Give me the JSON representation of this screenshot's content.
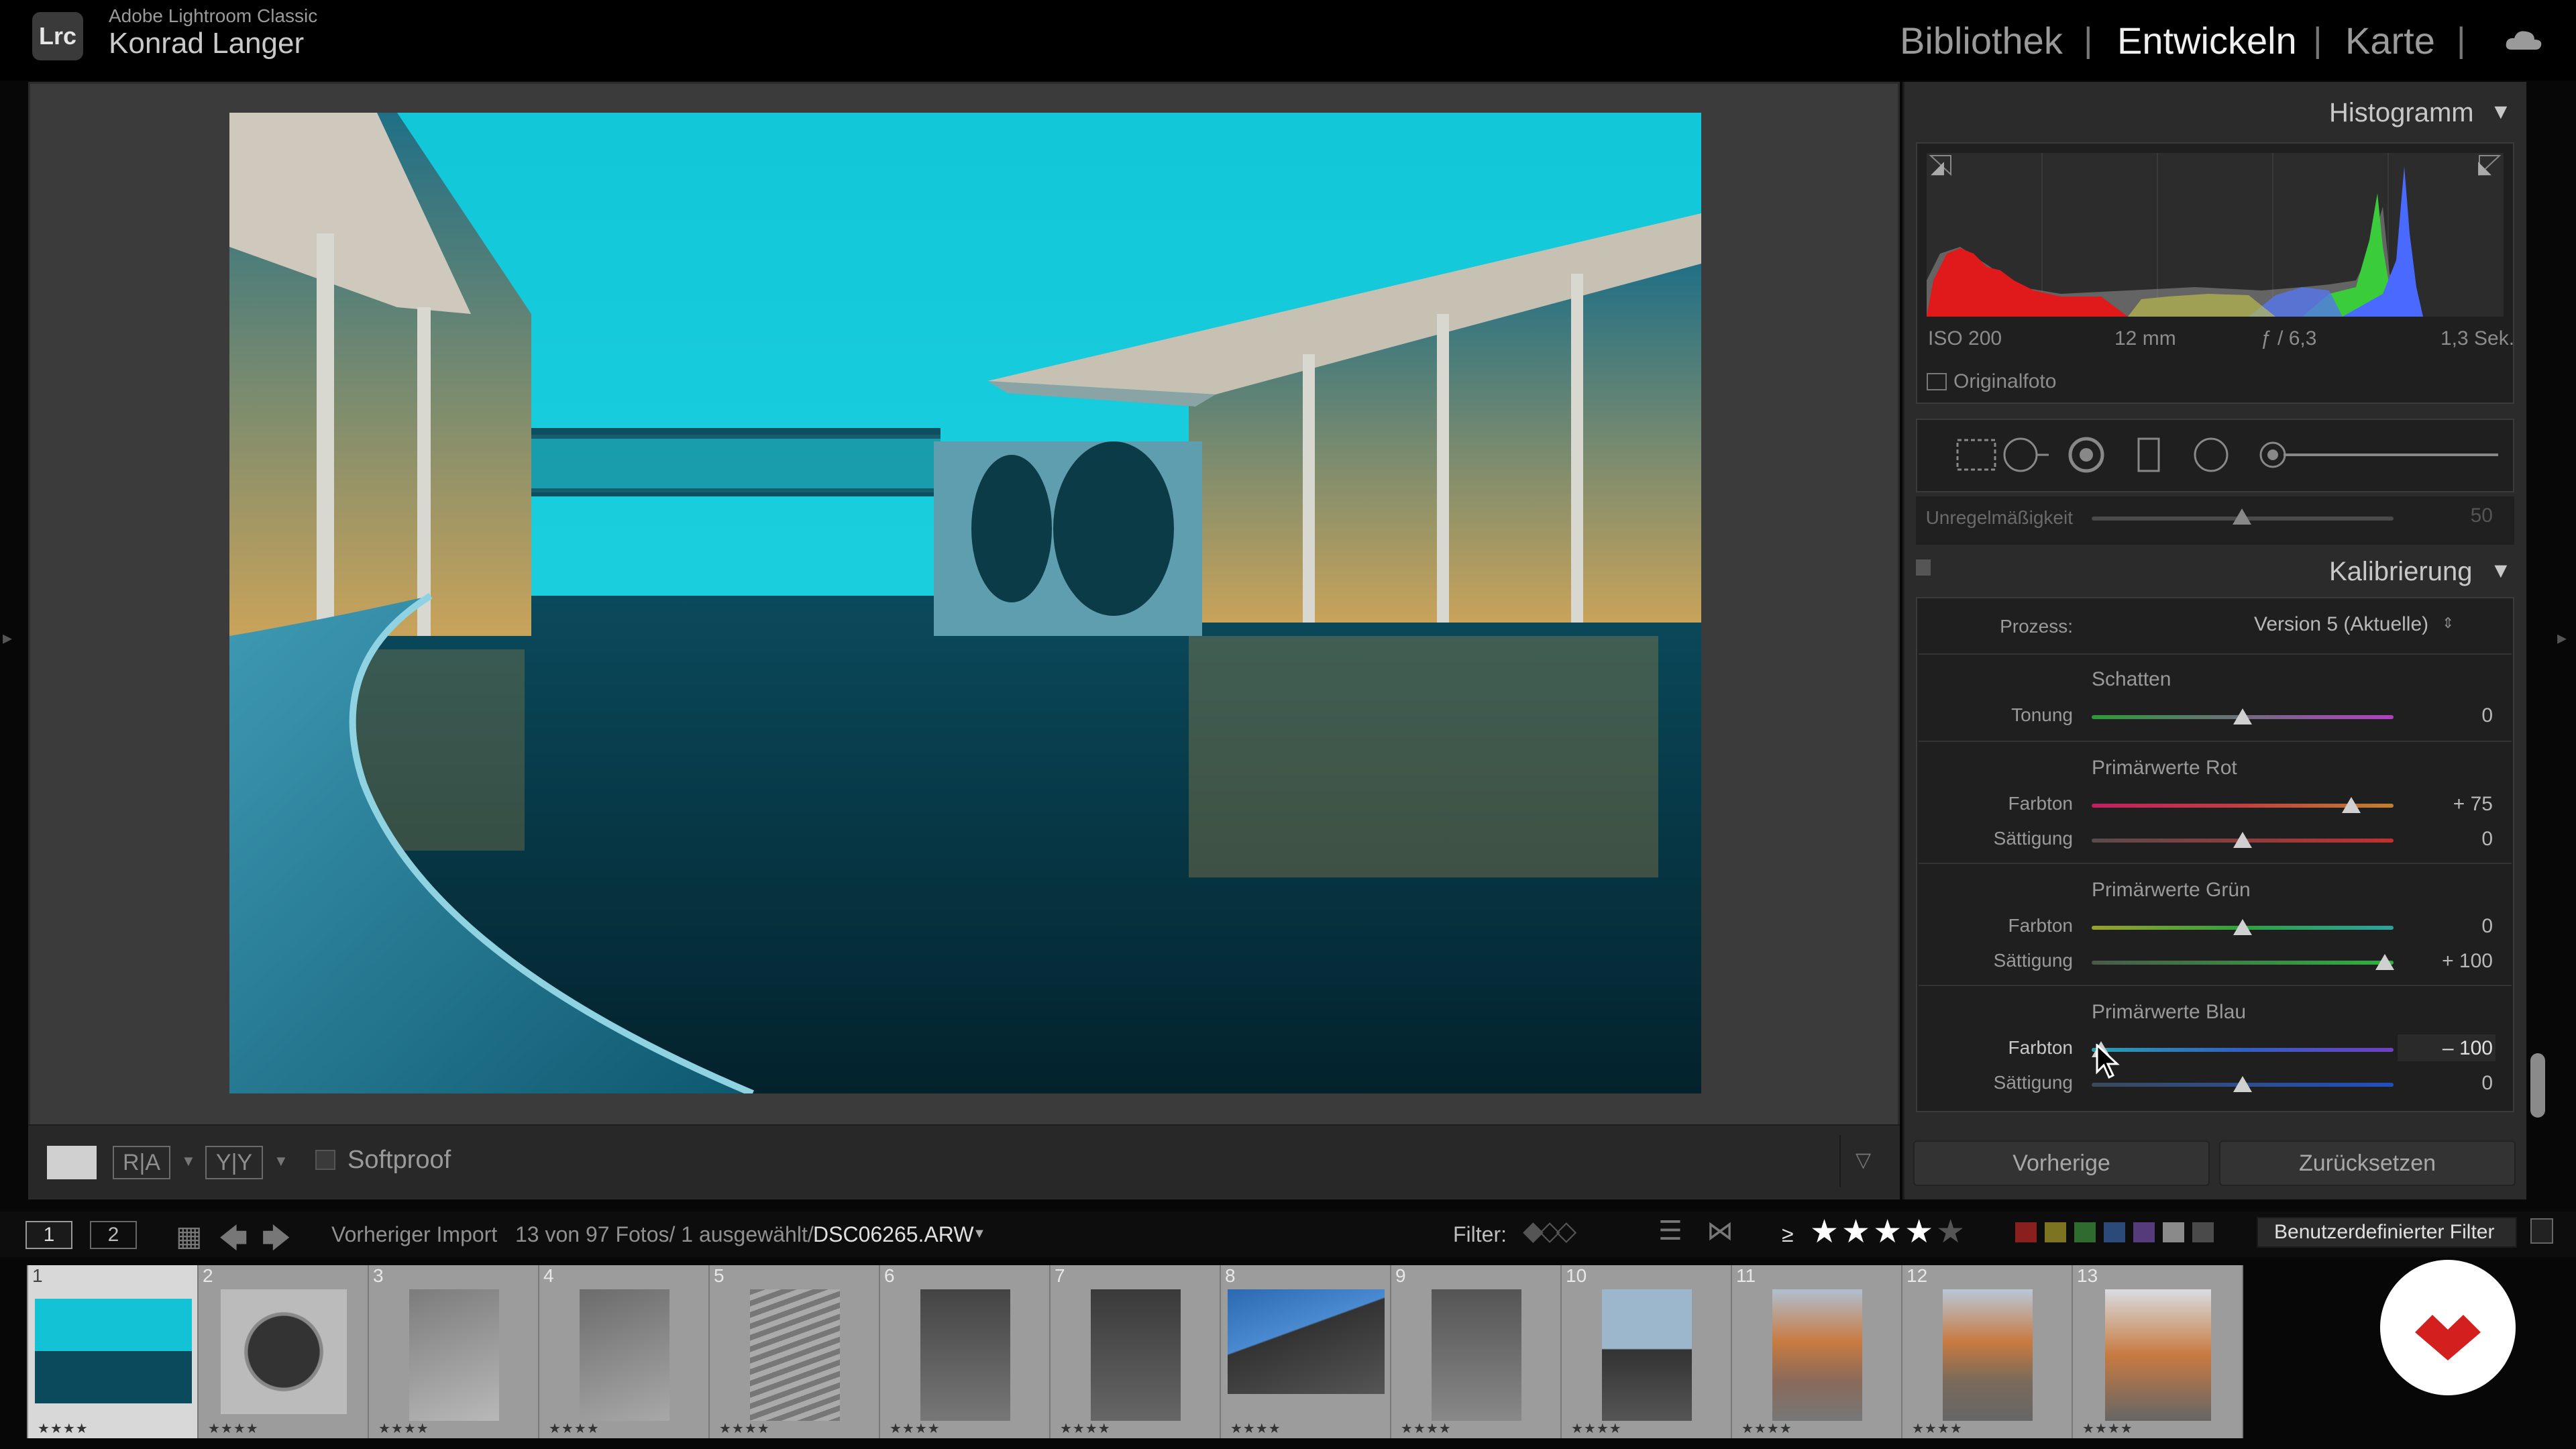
{
  "app": {
    "name": "Adobe Lightroom Classic",
    "logo": "Lrc",
    "user": "Konrad Langer"
  },
  "modules": [
    {
      "label": "Bibliothek",
      "active": false
    },
    {
      "label": "Entwickeln",
      "active": true
    },
    {
      "label": "Karte",
      "active": false
    }
  ],
  "toolbar": {
    "softproof_label": "Softproof",
    "compare_label": "R|A",
    "compare_label2": "Y|Y"
  },
  "histogram": {
    "title": "Histogramm",
    "iso": "ISO 200",
    "focal": "12 mm",
    "aperture": "ƒ / 6,3",
    "shutter": "1,3 Sek.",
    "original_label": "Originalfoto"
  },
  "grain": {
    "label": "Unregelmäßigkeit",
    "value": "50"
  },
  "calibration": {
    "title": "Kalibrierung",
    "process_label": "Prozess:",
    "process_value": "Version 5 (Aktuelle)",
    "sections": [
      {
        "title": "Schatten",
        "sliders": [
          {
            "label": "Tonung",
            "value": "0",
            "pos": 0.5,
            "track": "tint"
          }
        ]
      },
      {
        "title": "Primärwerte Rot",
        "sliders": [
          {
            "label": "Farbton",
            "value": "+ 75",
            "pos": 0.86,
            "track": "red-hue"
          },
          {
            "label": "Sättigung",
            "value": "0",
            "pos": 0.5,
            "track": "red-sat"
          }
        ]
      },
      {
        "title": "Primärwerte Grün",
        "sliders": [
          {
            "label": "Farbton",
            "value": "0",
            "pos": 0.5,
            "track": "green-hue"
          },
          {
            "label": "Sättigung",
            "value": "+ 100",
            "pos": 0.97,
            "track": "green-sat"
          }
        ]
      },
      {
        "title": "Primärwerte Blau",
        "sliders": [
          {
            "label": "Farbton",
            "value": "– 100",
            "pos": 0.03,
            "track": "blue-hue"
          },
          {
            "label": "Sättigung",
            "value": "0",
            "pos": 0.5,
            "track": "blue-sat"
          }
        ]
      }
    ]
  },
  "buttons": {
    "previous": "Vorherige",
    "reset": "Zurücksetzen"
  },
  "filmstrip_bar": {
    "page1": "1",
    "page2": "2",
    "source": "Vorheriger Import",
    "count": "13 von 97 Fotos/ 1 ausgewählt/",
    "filename": "DSC06265.ARW",
    "filter_label": "Filter:",
    "rating_op": "≥",
    "rating": 4,
    "custom_filter": "Benutzerdefinierter Filter",
    "color_labels": [
      "#8a1f1f",
      "#7c7420",
      "#2f6b2f",
      "#2b4a7a",
      "#553b7a",
      "#8a8a8a",
      "#4a4a4a"
    ]
  },
  "filmstrip": [
    {
      "n": "1",
      "stars": "★★★★",
      "selected": true
    },
    {
      "n": "2",
      "stars": "★★★★",
      "selected": false
    },
    {
      "n": "3",
      "stars": "★★★★",
      "selected": false
    },
    {
      "n": "4",
      "stars": "★★★★",
      "selected": false
    },
    {
      "n": "5",
      "stars": "★★★★",
      "selected": false
    },
    {
      "n": "6",
      "stars": "★★★★",
      "selected": false
    },
    {
      "n": "7",
      "stars": "★★★★",
      "selected": false
    },
    {
      "n": "8",
      "stars": "★★★★",
      "selected": false
    },
    {
      "n": "9",
      "stars": "★★★★",
      "selected": false
    },
    {
      "n": "10",
      "stars": "★★★★",
      "selected": false
    },
    {
      "n": "11",
      "stars": "★★★★",
      "selected": false
    },
    {
      "n": "12",
      "stars": "★★★★",
      "selected": false
    },
    {
      "n": "13",
      "stars": "★★★★",
      "selected": false
    }
  ]
}
